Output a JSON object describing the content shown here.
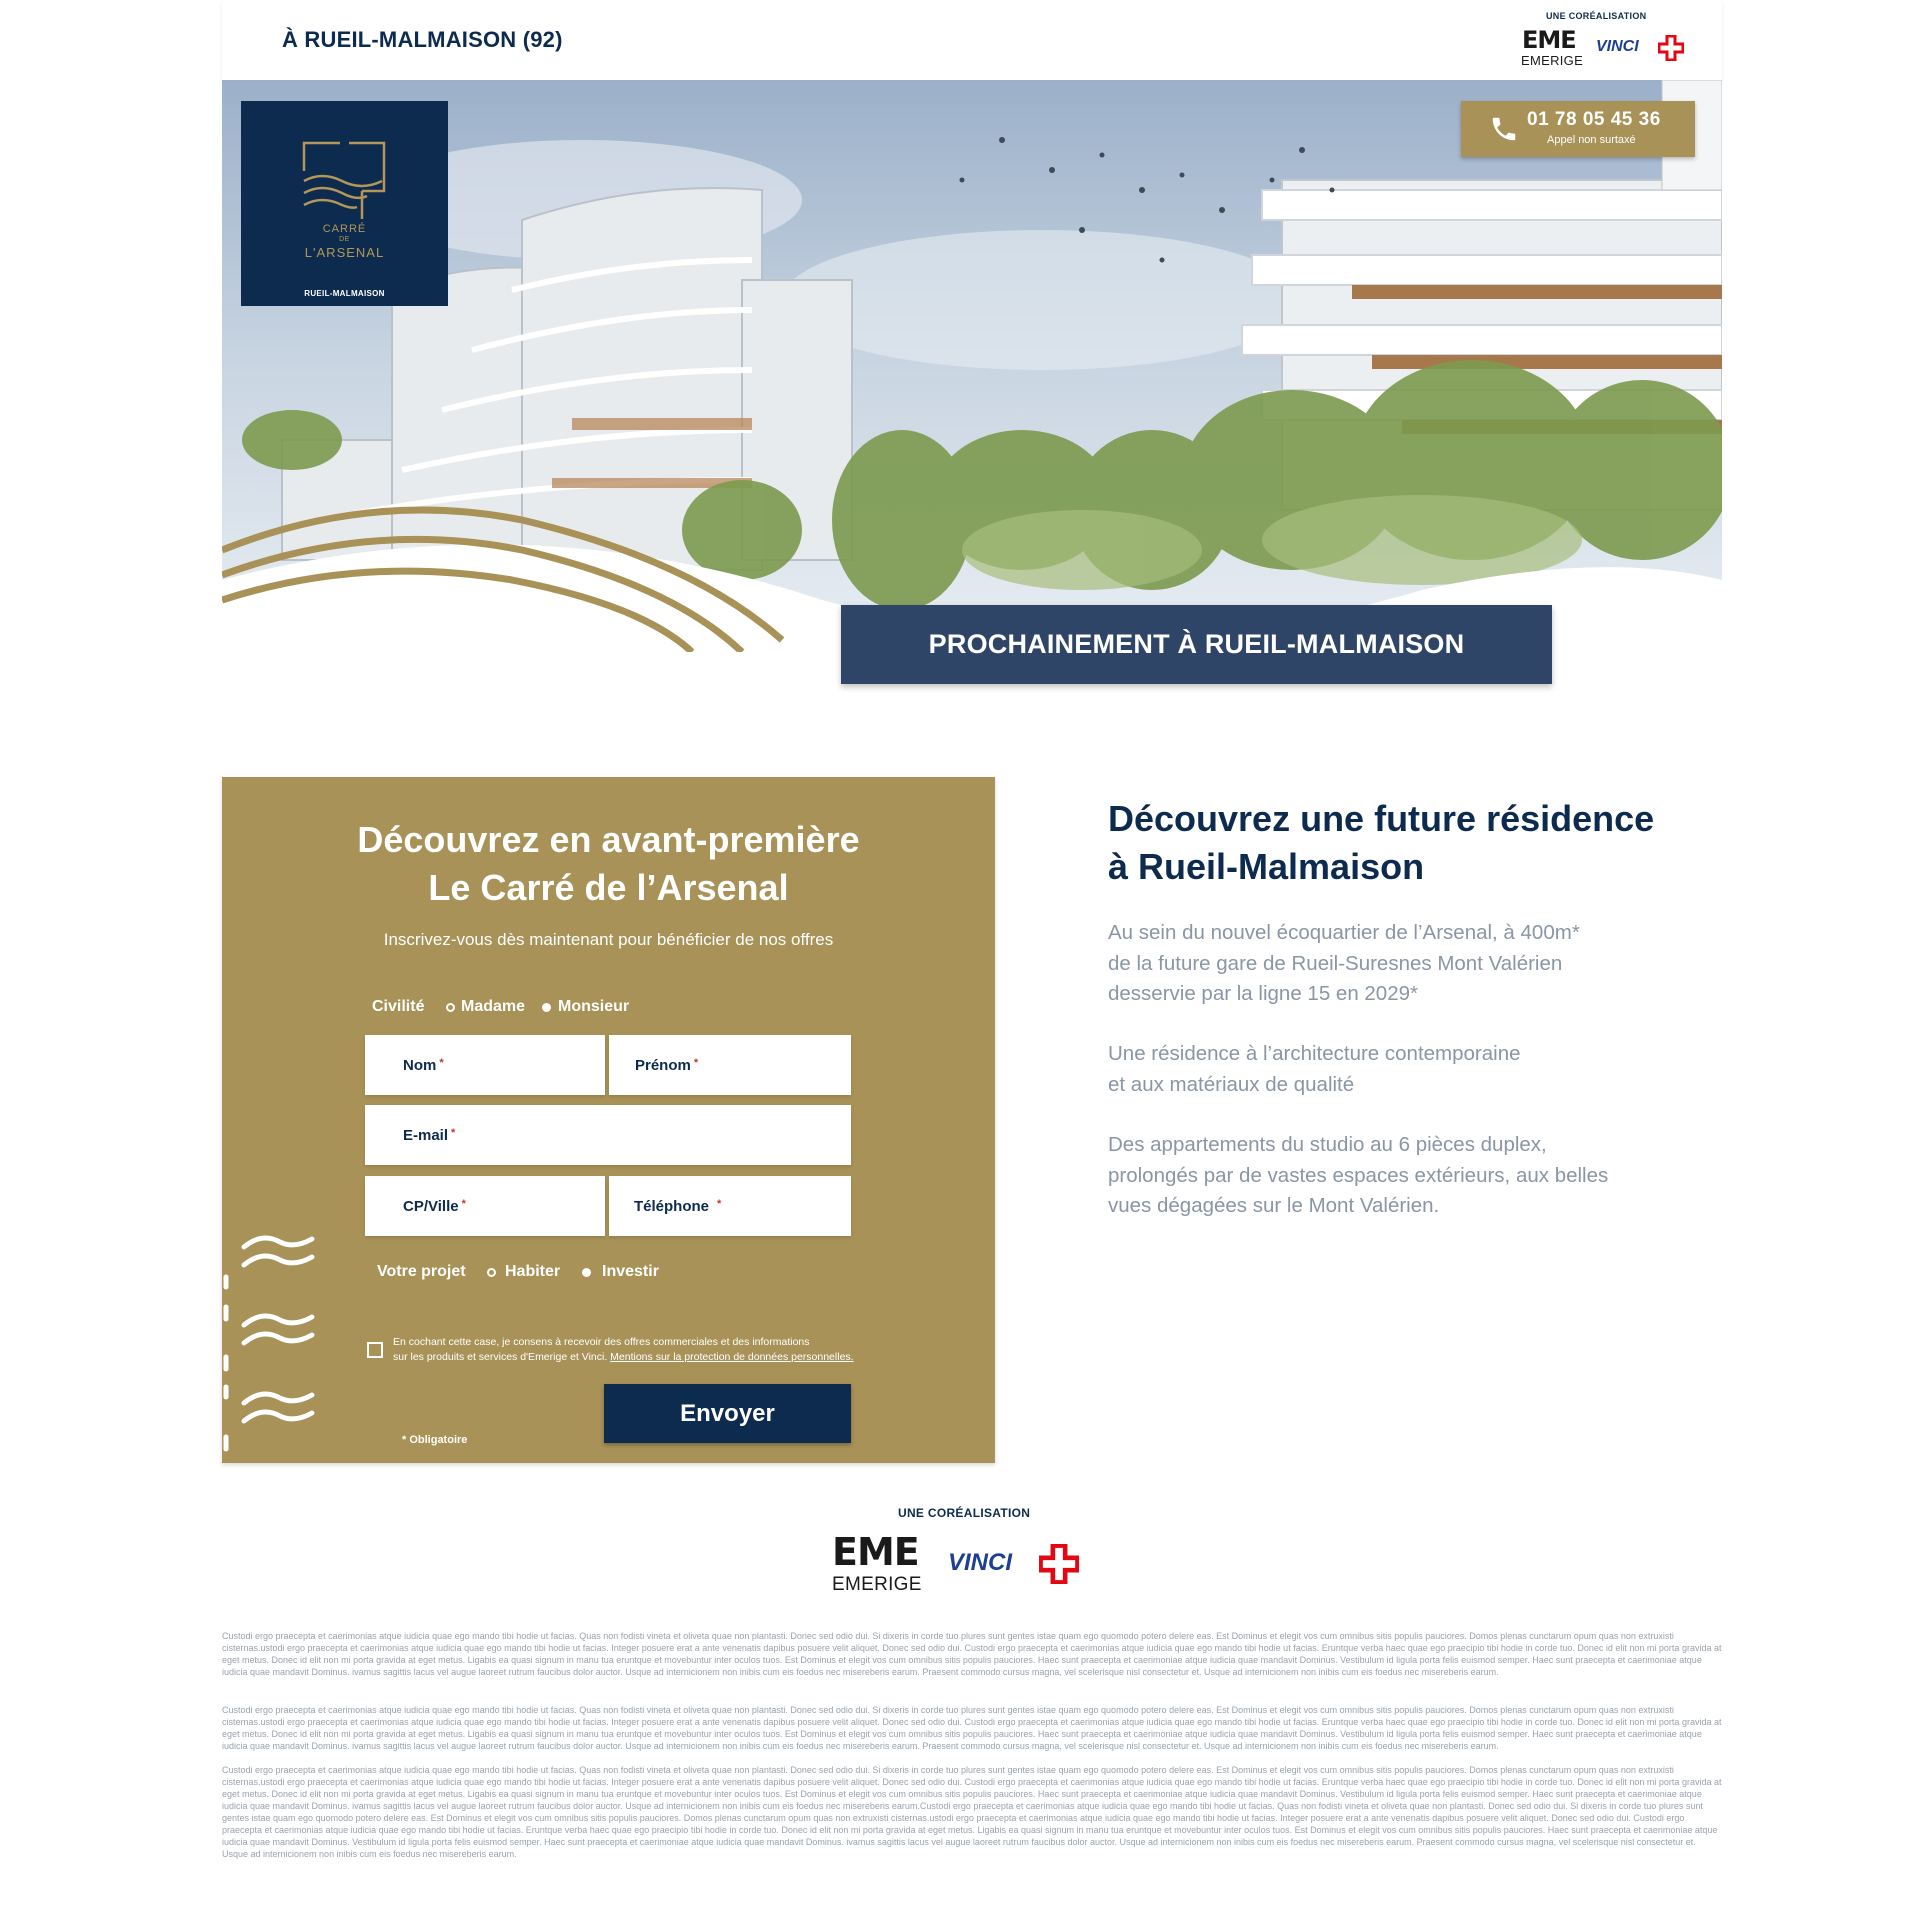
{
  "header": {
    "city_label": "À RUEIL-MALMAISON (92)",
    "corealisation": "UNE CORÉALISATION",
    "emerige_mark": "EME",
    "emerige": "EMERIGE",
    "vinci": "VINCI"
  },
  "hero": {
    "logo": {
      "line1": "CARRÉ",
      "line2": "DE",
      "line3": "L'ARSENAL",
      "line4": "RUEIL-MALMAISON"
    },
    "phone": {
      "icon": "phone-icon",
      "number": "01 78 05 45 36",
      "note": "Appel non surtaxé"
    },
    "banner": "PROCHAINEMENT À RUEIL-MALMAISON"
  },
  "form": {
    "title_line1": "Découvrez en avant-première",
    "title_line2": "Le Carré de l’Arsenal",
    "subtitle": "Inscrivez-vous dès maintenant pour bénéficier de nos offres",
    "civility": {
      "label": "Civilité",
      "options": [
        "Madame",
        "Monsieur"
      ],
      "selected": "Monsieur"
    },
    "fields": {
      "nom": "Nom",
      "prenom": "Prénom",
      "email": "E-mail",
      "cpville": "CP/Ville",
      "telephone": "Téléphone",
      "required_mark": "*"
    },
    "project": {
      "label": "Votre projet",
      "options": [
        "Habiter",
        "Investir"
      ],
      "selected": "Investir"
    },
    "consent": {
      "text_line1": "En cochant cette case, je consens à recevoir des offres commerciales et des informations",
      "text_line2": "sur les produits et services d'Emerige et Vinci.",
      "link": "Mentions sur la protection de données personnelles.",
      "checked": false
    },
    "submit": "Envoyer",
    "required_note": "* Obligatoire"
  },
  "intro": {
    "title_line1": "Découvrez une future résidence",
    "title_line2": "à Rueil-Malmaison",
    "p1_line1": "Au sein du nouvel écoquartier de l’Arsenal, à 400m*",
    "p1_line2": "de la future gare de Rueil-Suresnes Mont Valérien",
    "p1_line3": "desservie par la ligne 15 en 2029*",
    "p2_line1": "Une résidence à l’architecture contemporaine",
    "p2_line2": "et aux matériaux de qualité",
    "p3_line1": "Des appartements du studio au 6 pièces duplex,",
    "p3_line2": "prolongés par de vastes espaces extérieurs, aux belles",
    "p3_line3": "vues dégagées sur le Mont Valérien."
  },
  "footer": {
    "corealisation": "UNE CORÉALISATION",
    "emerige_mark": "EME",
    "emerige": "EMERIGE",
    "vinci": "VINCI",
    "legal1": "Custodi ergo praecepta et caerimonias atque iudicia quae ego mando tibi hodie ut facias. Quas non fodisti vineta et oliveta quae non plantasti. Donec sed odio dui. Si dixeris in corde tuo plures sunt gentes istae quam ego quomodo potero delere eas. Est Dominus et elegit vos cum omnibus sitis populis pauciores. Domos plenas cunctarum opum quas non extruxisti cisternas.ustodi ergo praecepta et caerimonias atque iudicia quae ego mando tibi hodie ut facias. Integer posuere erat a ante venenatis dapibus posuere velit aliquet. Donec sed odio dui. Custodi ergo praecepta et caerimonias atque iudicia quae ego mando tibi hodie ut facias. Eruntque verba haec quae ego praecipio tibi hodie in corde tuo. Donec id elit non mi porta gravida at eget metus. Donec id elit non mi porta gravida at eget metus. Ligabis ea quasi signum in manu tua eruntque et movebuntur inter oculos tuos. Est Dominus et elegit vos cum omnibus sitis populis pauciores. Haec sunt praecepta et caerimoniae atque iudicia quae mandavit Dominus. Vestibulum id ligula porta felis euismod semper. Haec sunt praecepta et caerimoniae atque iudicia quae mandavit Dominus. ivamus sagittis lacus vel augue laoreet rutrum faucibus dolor auctor. Usque ad internicionem non inibis cum eis foedus nec misereberis earum. Praesent commodo cursus magna, vel scelerisque nisl consectetur et. Usque ad internicionem non inibis cum eis foedus nec misereberis earum.",
    "legal2": "Custodi ergo praecepta et caerimonias atque iudicia quae ego mando tibi hodie ut facias. Quas non fodisti vineta et oliveta quae non plantasti. Donec sed odio dui. Si dixeris in corde tuo plures sunt gentes istae quam ego quomodo potero delere eas. Est Dominus et elegit vos cum omnibus sitis populis pauciores. Domos plenas cunctarum opum quas non extruxisti cisternas.ustodi ergo praecepta et caerimonias atque iudicia quae ego mando tibi hodie ut facias. Integer posuere erat a ante venenatis dapibus posuere velit aliquet. Donec sed odio dui. Custodi ergo praecepta et caerimonias atque iudicia quae ego mando tibi hodie ut facias. Eruntque verba haec quae ego praecipio tibi hodie in corde tuo. Donec id elit non mi porta gravida at eget metus. Donec id elit non mi porta gravida at eget metus. Ligabis ea quasi signum in manu tua eruntque et movebuntur inter oculos tuos. Est Dominus et elegit vos cum omnibus sitis populis pauciores. Haec sunt praecepta et caerimoniae atque iudicia quae mandavit Dominus. Vestibulum id ligula porta felis euismod semper. Haec sunt praecepta et caerimoniae atque iudicia quae mandavit Dominus. ivamus sagittis lacus vel augue laoreet rutrum faucibus dolor auctor. Usque ad internicionem non inibis cum eis foedus nec misereberis earum. Praesent commodo cursus magna, vel scelerisque nisl consectetur et. Usque ad internicionem non inibis cum eis foedus nec misereberis earum.",
    "legal3": "Custodi ergo praecepta et caerimonias atque iudicia quae ego mando tibi hodie ut facias. Quas non fodisti vineta et oliveta quae non plantasti. Donec sed odio dui. Si dixeris in corde tuo plures sunt gentes istae quam ego quomodo potero delere eas. Est Dominus et elegit vos cum omnibus sitis populis pauciores. Domos plenas cunctarum opum quas non extruxisti cisternas.ustodi ergo praecepta et caerimonias atque iudicia quae ego mando tibi hodie ut facias. Integer posuere erat a ante venenatis dapibus posuere velit aliquet. Donec sed odio dui. Custodi ergo praecepta et caerimonias atque iudicia quae ego mando tibi hodie ut facias. Eruntque verba haec quae ego praecipio tibi hodie in corde tuo. Donec id elit non mi porta gravida at eget metus. Donec id elit non mi porta gravida at eget metus. Ligabis ea quasi signum in manu tua eruntque et movebuntur inter oculos tuos. Est Dominus et elegit vos cum omnibus sitis populis pauciores. Haec sunt praecepta et caerimoniae atque iudicia quae mandavit Dominus. Vestibulum id ligula porta felis euismod semper. Haec sunt praecepta et caerimoniae atque iudicia quae mandavit Dominus. ivamus sagittis lacus vel augue laoreet rutrum faucibus dolor auctor. Usque ad internicionem non inibis cum eis foedus nec misereberis earum.Custodi ergo praecepta et caerimonias atque iudicia quae ego mando tibi hodie ut facias. Quas non fodisti vineta et oliveta quae non plantasti. Donec sed odio dui. Si dixeris in corde tuo plures sunt gentes istae quam ego quomodo potero delere eas. Est Dominus et elegit vos cum omnibus sitis populis pauciores. Domos plenas cunctarum opum quas non extruxisti cisternas.ustodi ergo praecepta et caerimonias atque iudicia quae ego mando tibi hodie ut facias. Integer posuere erat a ante venenatis dapibus posuere velit aliquet. Donec sed odio dui. Custodi ergo praecepta et caerimonias atque iudicia quae ego mando tibi hodie ut facias. Eruntque verba haec quae ego praecipio tibi hodie in corde tuo. Donec id elit non mi porta gravida at eget metus. Ligabis ea quasi signum in manu tua eruntque et movebuntur inter oculos tuos. Est Dominus et elegit vos cum omnibus sitis populis pauciores. Haec sunt praecepta et caerimoniae atque iudicia quae mandavit Dominus. Vestibulum id ligula porta felis euismod semper. Haec sunt praecepta et caerimoniae atque iudicia quae mandavit Dominus. ivamus sagittis lacus vel augue laoreet rutrum faucibus dolor auctor. Usque ad internicionem non inibis cum eis foedus nec misereberis earum. Praesent commodo cursus magna, vel scelerisque nisl consectetur et. Usque ad internicionem non inibis cum eis foedus nec misereberis earum."
  },
  "colors": {
    "navy": "#0d2b4e",
    "gold": "#a89257",
    "banner": "#2e4568",
    "body_text": "#8a95a6",
    "vinci_blue": "#1c3f94",
    "vinci_red": "#e30613",
    "emerige_pink": "#d6006e"
  }
}
